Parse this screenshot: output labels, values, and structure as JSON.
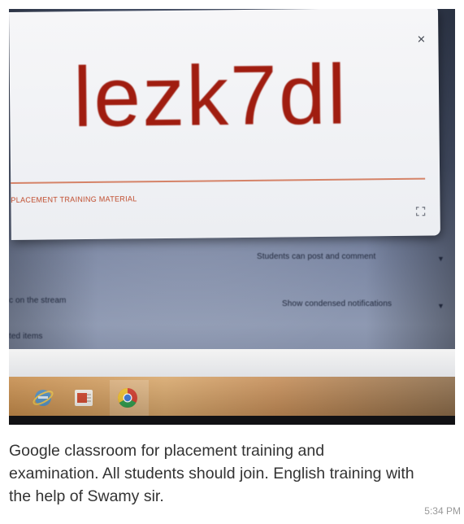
{
  "dialog": {
    "class_code": "lezk7dl",
    "class_name": "PLACEMENT TRAINING MATERIAL",
    "close_glyph": "×"
  },
  "settings": {
    "students_permission": "Students can post and comment",
    "stream_label": "c on the stream",
    "notifications": "Show condensed notifications",
    "items_label": "ted items"
  },
  "taskbar": {
    "icons": [
      "internet-explorer-icon",
      "office-icon",
      "chrome-icon"
    ]
  },
  "message": {
    "caption": "Google classroom for placement training and examination. All students should join. English training with the help of Swamy sir.",
    "timestamp": "5:34 PM"
  },
  "colors": {
    "code_red": "#a01d10",
    "accent_line": "#d0704f",
    "caption_text": "#333333",
    "timestamp_text": "#999999"
  }
}
